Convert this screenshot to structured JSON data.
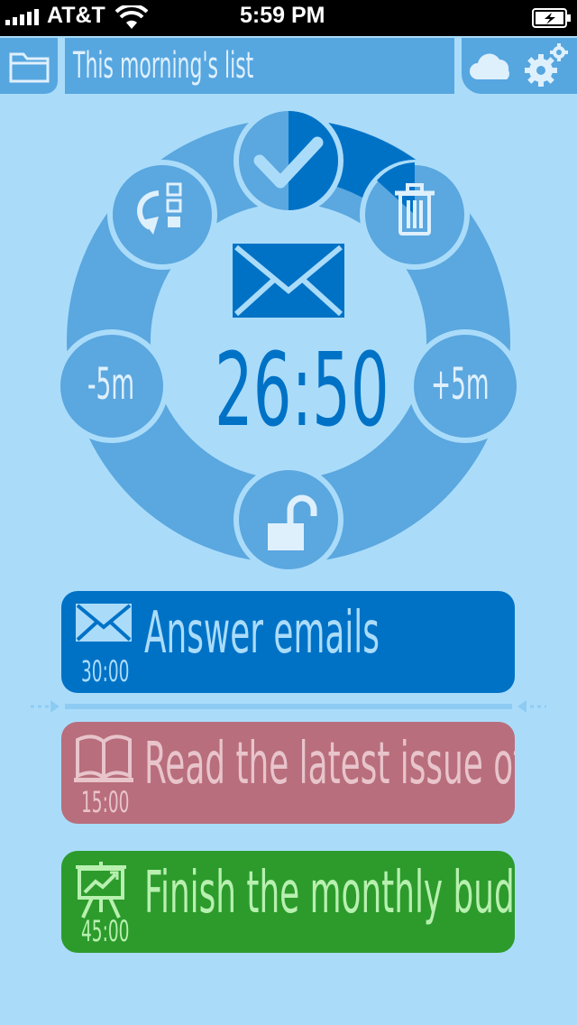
{
  "status_bar": {
    "carrier": "AT&T",
    "time": "5:59 PM"
  },
  "header": {
    "list_title": "This morning's list"
  },
  "timer": {
    "time_remaining": "26:50",
    "minus_label": "-5m",
    "plus_label": "+5m"
  },
  "tasks": [
    {
      "title": "Answer emails",
      "duration": "30:00",
      "icon": "envelope-icon",
      "color": "#0072c6"
    },
    {
      "title": "Read the latest issue of Tap! Magazine",
      "duration": "15:00",
      "icon": "book-icon",
      "color": "#b86e7c"
    },
    {
      "title": "Finish the monthly budget",
      "duration": "45:00",
      "icon": "presentation-chart-icon",
      "color": "#2c9b2c"
    }
  ],
  "colors": {
    "background": "#aadcfa",
    "ring": "#5ba7df",
    "accent_blue": "#0072c6",
    "muted_red": "#b86e7c",
    "green": "#2c9b2c"
  }
}
